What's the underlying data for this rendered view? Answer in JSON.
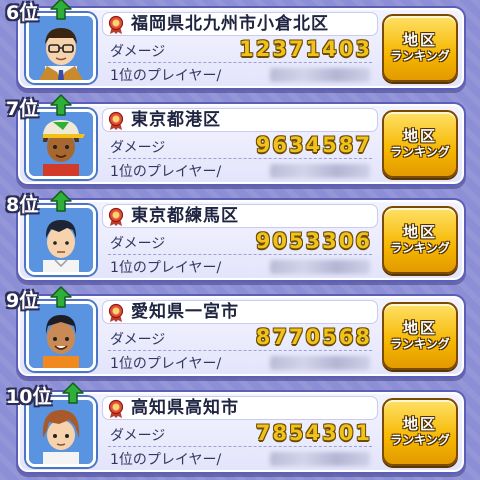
{
  "rankings": [
    {
      "rank": "6位",
      "region": "福岡県北九州市小倉北区",
      "damage": "12371403",
      "avatar": "man-glasses-tie",
      "trend": "up"
    },
    {
      "rank": "7位",
      "region": "東京都港区",
      "damage": "9634587",
      "avatar": "boy-cap",
      "trend": "up"
    },
    {
      "rank": "8位",
      "region": "東京都練馬区",
      "damage": "9053306",
      "avatar": "boy-short-hair",
      "trend": "up"
    },
    {
      "rank": "9位",
      "region": "愛知県一宮市",
      "damage": "8770568",
      "avatar": "boy-tan",
      "trend": "up"
    },
    {
      "rank": "10位",
      "region": "高知県高知市",
      "damage": "7854301",
      "avatar": "boy-brown-hair",
      "trend": "up"
    }
  ],
  "labels": {
    "damage": "ダメージ",
    "top_player": "1位のプレイヤー/",
    "button_line1": "地区",
    "button_line2": "ランキング"
  },
  "colors": {
    "panel_border": "#5b5fb7",
    "damage_value": "#f1c21b",
    "button": "#f5b700",
    "up_arrow": "#2fae3a"
  }
}
